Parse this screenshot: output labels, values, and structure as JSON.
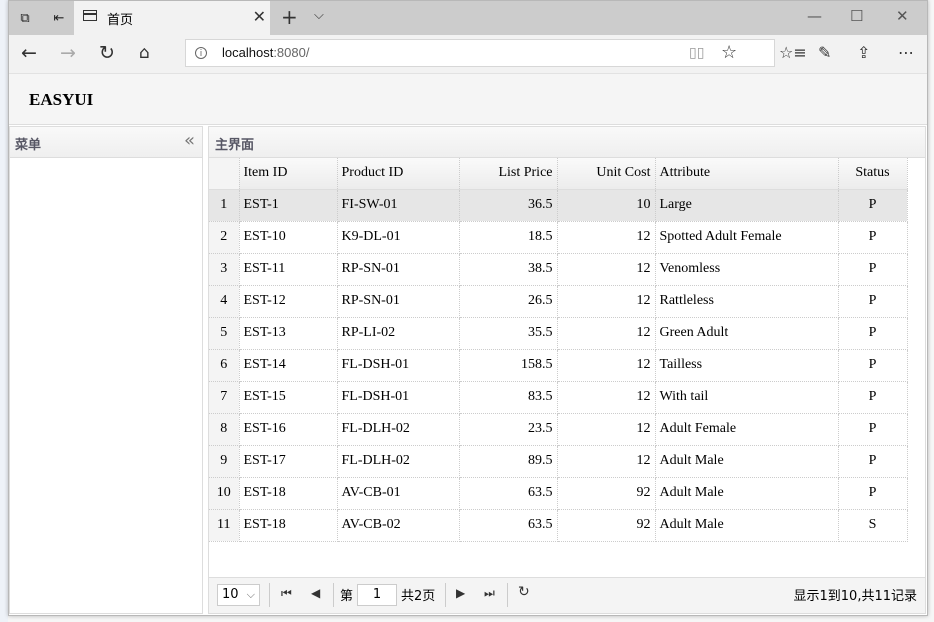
{
  "browser": {
    "tab_title": "首页",
    "url_host": "localhost",
    "url_rest": ":8080/"
  },
  "app": {
    "brand": "EASYUI",
    "west_title": "菜单",
    "center_title": "主界面"
  },
  "grid": {
    "columns": [
      "Item ID",
      "Product ID",
      "List Price",
      "Unit Cost",
      "Attribute",
      "Status"
    ],
    "rows": [
      {
        "n": "1",
        "item": "EST-1",
        "product": "FI-SW-01",
        "price": "36.5",
        "cost": "10",
        "attr": "Large",
        "status": "P"
      },
      {
        "n": "2",
        "item": "EST-10",
        "product": "K9-DL-01",
        "price": "18.5",
        "cost": "12",
        "attr": "Spotted Adult Female",
        "status": "P"
      },
      {
        "n": "3",
        "item": "EST-11",
        "product": "RP-SN-01",
        "price": "38.5",
        "cost": "12",
        "attr": "Venomless",
        "status": "P"
      },
      {
        "n": "4",
        "item": "EST-12",
        "product": "RP-SN-01",
        "price": "26.5",
        "cost": "12",
        "attr": "Rattleless",
        "status": "P"
      },
      {
        "n": "5",
        "item": "EST-13",
        "product": "RP-LI-02",
        "price": "35.5",
        "cost": "12",
        "attr": "Green Adult",
        "status": "P"
      },
      {
        "n": "6",
        "item": "EST-14",
        "product": "FL-DSH-01",
        "price": "158.5",
        "cost": "12",
        "attr": "Tailless",
        "status": "P"
      },
      {
        "n": "7",
        "item": "EST-15",
        "product": "FL-DSH-01",
        "price": "83.5",
        "cost": "12",
        "attr": "With tail",
        "status": "P"
      },
      {
        "n": "8",
        "item": "EST-16",
        "product": "FL-DLH-02",
        "price": "23.5",
        "cost": "12",
        "attr": "Adult Female",
        "status": "P"
      },
      {
        "n": "9",
        "item": "EST-17",
        "product": "FL-DLH-02",
        "price": "89.5",
        "cost": "12",
        "attr": "Adult Male",
        "status": "P"
      },
      {
        "n": "10",
        "item": "EST-18",
        "product": "AV-CB-01",
        "price": "63.5",
        "cost": "92",
        "attr": "Adult Male",
        "status": "P"
      },
      {
        "n": "11",
        "item": "EST-18",
        "product": "AV-CB-02",
        "price": "63.5",
        "cost": "92",
        "attr": "Adult Male",
        "status": "S"
      }
    ],
    "selected_row": 1
  },
  "pager": {
    "page_size": "10",
    "page_prefix": "第",
    "page_number": "1",
    "page_suffix": "共2页",
    "summary": "显示1到10,共11记录"
  }
}
